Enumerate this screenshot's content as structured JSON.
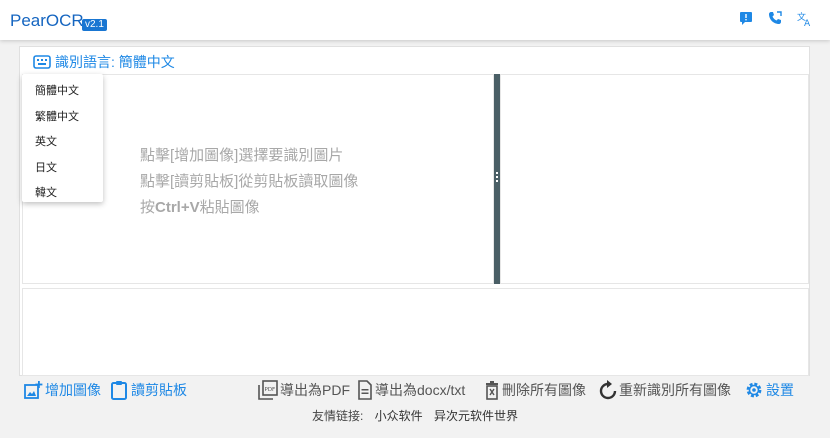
{
  "app": {
    "title": "PearOCR",
    "version": "v2.1"
  },
  "header_icons": [
    "feedback-icon",
    "phone-icon",
    "translate-icon"
  ],
  "language_bar": {
    "label": "識別語言: 簡體中文"
  },
  "language_options": [
    "簡體中文",
    "繁體中文",
    "英文",
    "日文",
    "韓文"
  ],
  "hints": {
    "line1": "點擊[增加圖像]選擇要識別圖片",
    "line2": "點擊[讀剪貼板]從剪貼板讀取圖像",
    "line3_prefix": "按",
    "line3_key": "Ctrl+V",
    "line3_suffix": "粘貼圖像"
  },
  "toolbar": {
    "add_image": "增加圖像",
    "read_clipboard": "讀剪貼板",
    "export_pdf": "導出為PDF",
    "export_docx": "導出為docx/txt",
    "delete_all": "刪除所有圖像",
    "reidentify_all": "重新識別所有圖像",
    "settings": "設置"
  },
  "footer": {
    "label": "友情链接:",
    "links": [
      "小众软件",
      "异次元软件世界"
    ]
  },
  "colors": {
    "accent": "#1e88e5",
    "splitter": "#4a5f66",
    "brand": "#1565c0"
  }
}
